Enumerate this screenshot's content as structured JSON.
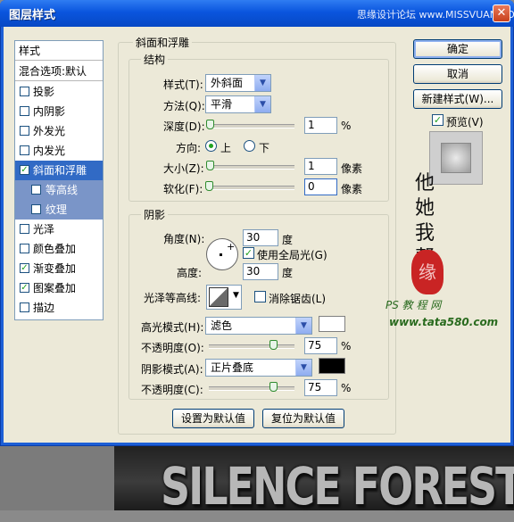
{
  "window": {
    "title": "图层样式",
    "watermark": "思缘设计论坛 www.MISSVUAN.COM"
  },
  "styles": {
    "header": "样式",
    "blend_options": "混合选项:默认",
    "items": [
      {
        "label": "投影",
        "checked": false
      },
      {
        "label": "内阴影",
        "checked": false
      },
      {
        "label": "外发光",
        "checked": false
      },
      {
        "label": "内发光",
        "checked": false
      },
      {
        "label": "斜面和浮雕",
        "checked": true,
        "selected": true
      },
      {
        "label": "等高线",
        "checked": false,
        "sub": true
      },
      {
        "label": "纹理",
        "checked": false,
        "sub": true
      },
      {
        "label": "光泽",
        "checked": false
      },
      {
        "label": "颜色叠加",
        "checked": false
      },
      {
        "label": "渐变叠加",
        "checked": true
      },
      {
        "label": "图案叠加",
        "checked": true
      },
      {
        "label": "描边",
        "checked": false
      }
    ]
  },
  "bevel": {
    "title": "斜面和浮雕",
    "structure": {
      "title": "结构",
      "style_label": "样式(T):",
      "style_value": "外斜面",
      "technique_label": "方法(Q):",
      "technique_value": "平滑",
      "depth_label": "深度(D):",
      "depth_value": "1",
      "depth_unit": "%",
      "direction_label": "方向:",
      "dir_up": "上",
      "dir_down": "下",
      "direction_selected": "上",
      "size_label": "大小(Z):",
      "size_value": "1",
      "size_unit": "像素",
      "soften_label": "软化(F):",
      "soften_value": "0",
      "soften_unit": "像素"
    },
    "shading": {
      "title": "阴影",
      "angle_label": "角度(N):",
      "angle_value": "30",
      "angle_unit": "度",
      "global_light_label": "使用全局光(G)",
      "global_light": true,
      "altitude_label": "高度:",
      "altitude_value": "30",
      "altitude_unit": "度",
      "gloss_contour_label": "光泽等高线:",
      "anti_alias_label": "消除锯齿(L)",
      "anti_alias": false,
      "highlight_mode_label": "高光模式(H):",
      "highlight_mode": "滤色",
      "highlight_color": "#ffffff",
      "highlight_opacity_label": "不透明度(O):",
      "highlight_opacity": "75",
      "highlight_unit": "%",
      "shadow_mode_label": "阴影模式(A):",
      "shadow_mode": "正片叠底",
      "shadow_color": "#000000",
      "shadow_opacity_label": "不透明度(C):",
      "shadow_opacity": "75",
      "shadow_unit": "%"
    },
    "make_default": "设置为默认值",
    "reset_default": "复位为默认值"
  },
  "buttons": {
    "ok": "确定",
    "cancel": "取消",
    "new_style": "新建样式(W)...",
    "preview_label": "预览(V)",
    "preview": true
  },
  "levels": {
    "depth_fraction": 0.01,
    "size_fraction": 0.01,
    "soften_fraction": 0,
    "highlight_opacity_fraction": 0.75,
    "shadow_opacity_fraction": 0.75
  },
  "watermarks": {
    "handwriting": "他\n她\n我\n帮\n你",
    "seal": "缘",
    "ps_site": "PS 教 程 网",
    "url": "www.tata580.com"
  },
  "canvas_text": "SILENCE FOREST"
}
